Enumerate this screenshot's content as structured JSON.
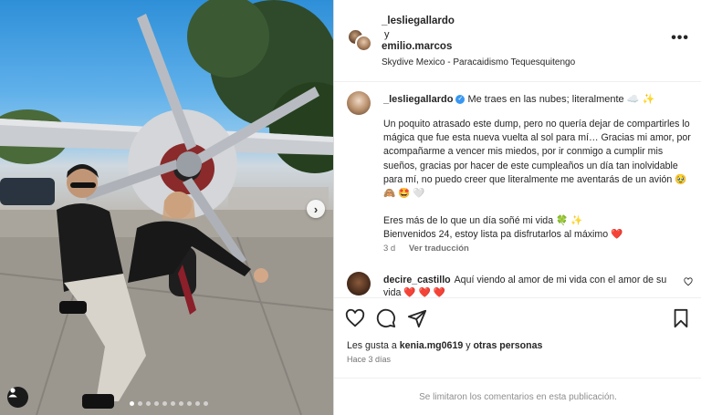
{
  "header": {
    "user1": "_lesliegallardo",
    "and_word": "y",
    "user2": "emilio.marcos",
    "location": "Skydive Mexico - Paracaidismo Tequesquitengo",
    "more_glyph": "•••"
  },
  "caption": {
    "username": "_lesliegallardo",
    "first_line": "Me traes en las nubes; literalmente ☁️ ✨",
    "paragraph1": "Un poquito atrasado este dump, pero no quería dejar de compartirles lo mágica que fue esta nueva vuelta al sol para mí… Gracias mi amor, por acompañarme a vencer mis miedos, por ir conmigo a cumplir mis sueños, gracias por hacer de este cumpleaños un día tan inolvidable para mí, no puedo creer que literalmente me aventarás de un avión 🥹 🙈 🤩 🤍",
    "paragraph2_line1": "Eres más de lo que un día soñé mi vida 🍀 ✨",
    "paragraph2_line2": "Bienvenidos 24, estoy lista pa disfrutarlos al máximo ❤️",
    "age": "3 d",
    "translate": "Ver traducción"
  },
  "comment": {
    "username": "decire_castillo",
    "text": "Aquí viendo al amor de mi vida con el amor de su vida ❤️ ❤️ ❤️"
  },
  "actions": {
    "likes_prefix": "Les gusta a",
    "likes_user": "kenia.mg0619",
    "likes_connector": "y",
    "likes_others": "otras personas",
    "posted": "Hace 3 días"
  },
  "footer": {
    "limited_text": "Se limitaron los comentarios en esta publicación."
  },
  "carousel": {
    "next_glyph": "›",
    "active_index": 0,
    "count": 10
  },
  "icons": [
    "heart-icon",
    "comment-icon",
    "share-icon",
    "bookmark-icon",
    "user-tag-icon",
    "verified-icon",
    "more-options-icon"
  ],
  "colors": {
    "verified": "#3897f0",
    "muted": "#737373",
    "divider": "#dbdbdb"
  }
}
